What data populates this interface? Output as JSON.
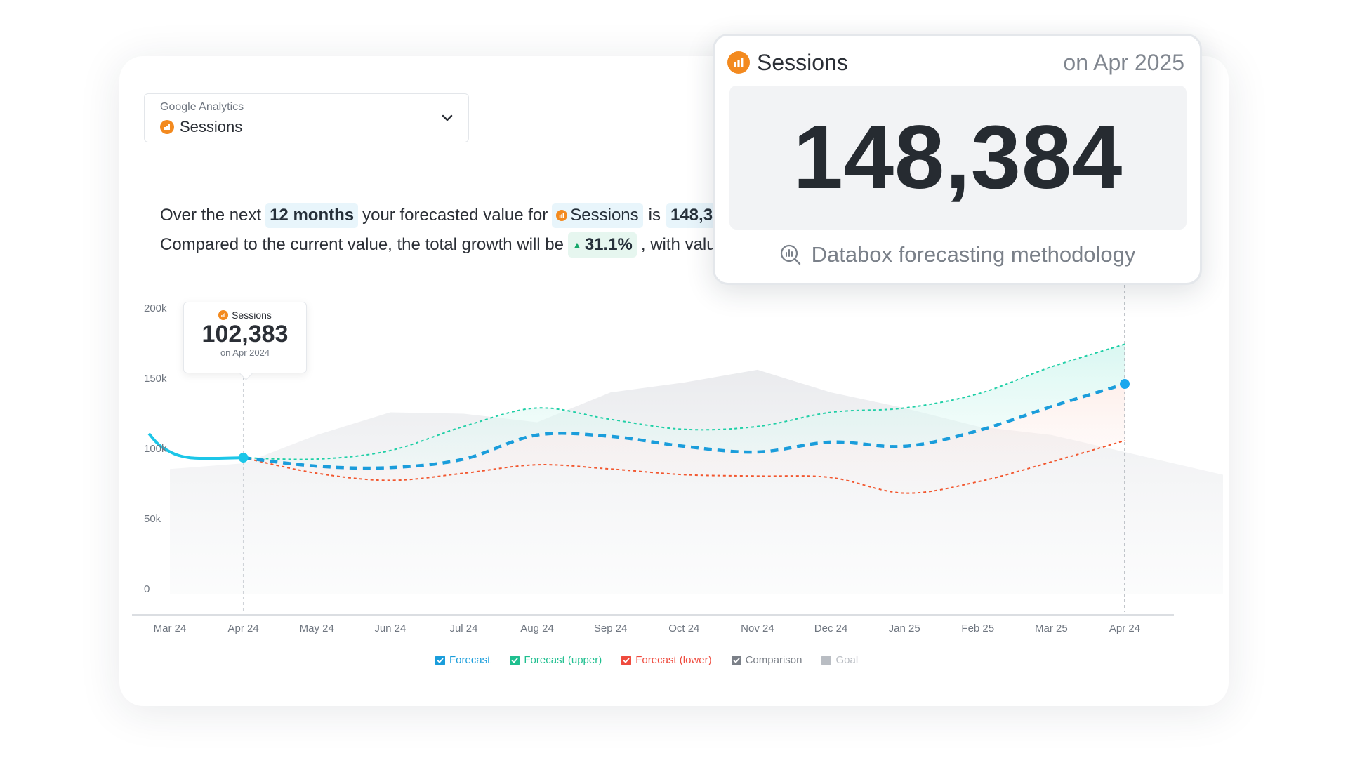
{
  "selector": {
    "source": "Google Analytics",
    "metric": "Sessions",
    "icon": "chevron-down-icon"
  },
  "summary": {
    "line1_prefix": "Over the next",
    "period": "12 months",
    "line1_mid": "your forecasted value for",
    "metric": "Sessions",
    "is": "is",
    "value_partial": "148,38",
    "line2_prefix": "Compared to the current value, the total growth will be",
    "growth": "31.1%",
    "line2_suffix": ", with valu"
  },
  "tooltip": {
    "metric": "Sessions",
    "value": "102,383",
    "date": "on Apr 2024"
  },
  "popup": {
    "metric": "Sessions",
    "date": "on Apr 2025",
    "value": "148,384",
    "link": "Databox forecasting methodology",
    "link_icon": "search-chart-icon"
  },
  "legend": [
    {
      "label": "Forecast",
      "color": "#1a9ddb",
      "checked": true
    },
    {
      "label": "Forecast (upper)",
      "color": "#1fbf8f",
      "checked": true
    },
    {
      "label": "Forecast (lower)",
      "color": "#ef4b3e",
      "checked": true
    },
    {
      "label": "Comparison",
      "color": "#7b8088",
      "checked": true
    },
    {
      "label": "Goal",
      "color": "#b9bdc3",
      "checked": false
    }
  ],
  "colors": {
    "accent": "#f38a1f",
    "forecast": "#1a9ddb",
    "actual": "#1cc6e8",
    "upper": "#1fcfa6",
    "lower": "#f2572f"
  },
  "chart_data": {
    "type": "line",
    "categories": [
      "Mar 24",
      "Apr 24",
      "May 24",
      "Jun 24",
      "Jul 24",
      "Aug 24",
      "Sep 24",
      "Oct 24",
      "Nov 24",
      "Dec 24",
      "Jan 25",
      "Feb 25",
      "Mar 25",
      "Apr 24"
    ],
    "y_ticks": [
      "0",
      "50k",
      "100k",
      "150k",
      "200k"
    ],
    "ylim": [
      0,
      200000
    ],
    "grid": false,
    "legend_position": "bottom",
    "series": [
      {
        "name": "Forecast",
        "values": [
          106000,
          96000,
          90000,
          89000,
          95000,
          112000,
          111000,
          104000,
          100000,
          107000,
          104000,
          115000,
          132000,
          148000
        ]
      },
      {
        "name": "Forecast (upper)",
        "values": [
          106000,
          96000,
          95000,
          101000,
          118000,
          131000,
          123000,
          116000,
          118000,
          128000,
          131000,
          141000,
          160000,
          176000
        ]
      },
      {
        "name": "Forecast (lower)",
        "values": [
          106000,
          96000,
          85000,
          80000,
          85000,
          91000,
          88000,
          84000,
          83000,
          82000,
          71000,
          79000,
          93000,
          108000
        ]
      },
      {
        "name": "Comparison",
        "values": [
          88000,
          92000,
          112000,
          128000,
          127000,
          121000,
          142000,
          149000,
          158000,
          142000,
          131000,
          118000,
          112000,
          100000
        ]
      }
    ]
  }
}
